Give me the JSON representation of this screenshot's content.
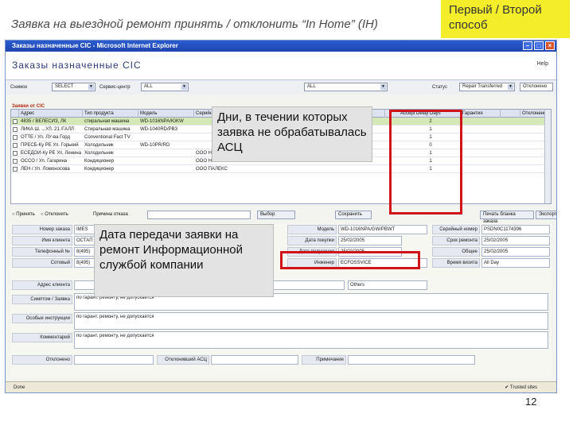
{
  "slide": {
    "title": "Заявка на выездной ремонт принять / отклонить “In Home” (IH)",
    "callout_method": "Первый / Второй способ",
    "callout_days": "Дни, в течении которых заявка не обрабатывалась АСЦ",
    "callout_date": "Дата передачи заявки на ремонт Информационной службой компании",
    "page_number": "12"
  },
  "window": {
    "title": "Заказы назначенные CIC - Microsoft Internet Explorer",
    "app_title": "Заказы назначенные CIC",
    "help": "Help",
    "status_left": "Done",
    "status_right": "Trusted sites"
  },
  "filters": {
    "f1_label": "Снимок",
    "f1_value": "SELECT",
    "f2_label": "Сервис-центр",
    "f2_value": "ALL",
    "f3_value": "ALL",
    "f4_label": "Статус",
    "f4_value": "Repair Transferred",
    "f5_value": "Отклонено"
  },
  "grid": {
    "section_label": "Заявки от CIC",
    "headers": [
      "Адрес",
      "Тип продукта",
      "Модель",
      "Серийный №",
      "",
      "",
      "",
      "Accept Delay Days",
      "Гарантия",
      "",
      "Отклонено"
    ],
    "rows": [
      {
        "address": "4835 / ВЕЛЕСИЗ, ЛК",
        "product": "стиральная машина",
        "model": "WD-1016NPA/ЮKW",
        "serial": "",
        "days": "2"
      },
      {
        "address": "ЛИКА Ш. ...УЛ. 21 /ГАЛЛ",
        "product": "Стиральная машина",
        "model": "WD-1040RD/PB3",
        "serial": "",
        "days": "1"
      },
      {
        "address": "ОТТЕ / Ул. ЛУ-ва Горд",
        "product": "Conventional Fact TV",
        "model": "",
        "serial": "",
        "days": "1"
      },
      {
        "address": "ПРЕСБ-Ку РЕ Ул. Горький",
        "product": "Холодильник",
        "model": "WD-10PR/RD",
        "serial": "",
        "days": "0"
      },
      {
        "address": "ЕСЕДОИ-Ку РЕ Ул. Ленина",
        "product": "Холодильник",
        "model": "",
        "serial": "ООО НЕНА",
        "days": "1"
      },
      {
        "address": "ОССО / Ул. Гагарина",
        "product": "Кондиционер",
        "model": "",
        "serial": "ООО НЕКС",
        "days": "1"
      },
      {
        "address": "ЛЕН / Ул. Ломоносова",
        "product": "Кондиционер",
        "model": "",
        "serial": "ООО ПАЛЕКС",
        "days": "1"
      }
    ]
  },
  "actions": {
    "accept": "Принять",
    "reject": "Отклонить",
    "reason": "Причина отказа",
    "select": "Выбор",
    "save": "Сохранить",
    "print": "Печать бланка заказа",
    "export": "Экспорт в Excel"
  },
  "form": {
    "order_no_label": "Номер заказа",
    "order_no": "IMES",
    "name_label": "Имя клиента",
    "name": "ОСТАП",
    "phone_label": "Телефонный №",
    "phone": "8(495)",
    "mobile_label": "Сотовый",
    "mobile": "8(495)",
    "model_label": "Модель",
    "model": "WD-1016NPA/GW/PBWT",
    "warranty_label": "Дата покупки",
    "warranty": "25/02/2005",
    "received_label": "Дата получения",
    "received": "25/02/2005",
    "engineer_label": "Инженер",
    "engineer": "ECFOSSVICE",
    "serial_label": "Серийный номер",
    "serial": "PSDN0C1174396",
    "deadline_label": "Срок ремонта",
    "deadline": "25/02/2005",
    "common_label": "Общее",
    "common": "25/02/2005",
    "visit_label": "Время визита",
    "visit": "All Day",
    "address_label": "Адрес клиента",
    "symptom_label": "Симптом / Заявка",
    "symptom_value": "по гарант. ремонту, не допускается",
    "special_label": "Особые инструкции",
    "special_value": "по гарант. ремонту, не допускается",
    "comment_label": "Комментарий",
    "comment_value": "по гарант. ремонту, не допускается",
    "reject_label": "Отклонено",
    "reject_asc_label": "Отклонивший АСЦ",
    "note_label": "Примечание",
    "other_value": "Others"
  }
}
